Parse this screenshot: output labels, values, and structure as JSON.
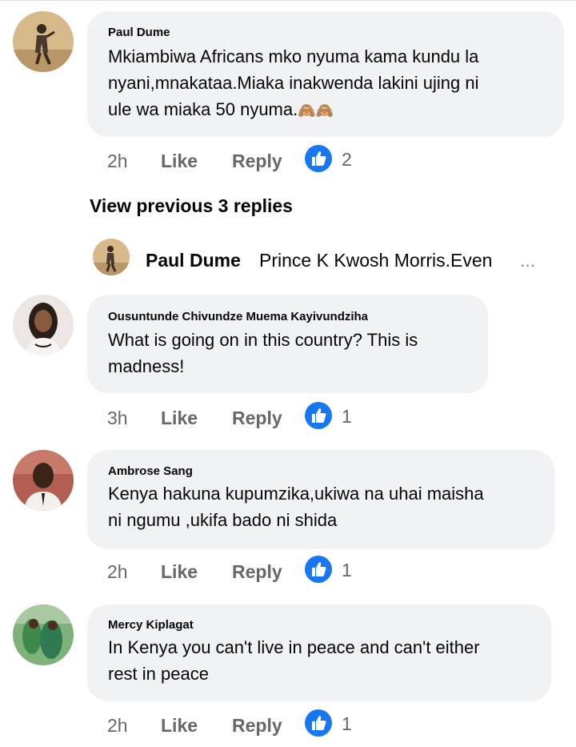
{
  "comments": [
    {
      "author": "Paul Dume",
      "lines": [
        "Mkiambiwa Africans mko nyuma kama kundu la",
        "nyani,mnakataa.Miaka inakwenda lakini ujing ni",
        "ule wa miaka 50 nyuma."
      ],
      "emoji": "🙈🙈",
      "time": "2h",
      "like_label": "Like",
      "reply_label": "Reply",
      "likes": "2"
    },
    {
      "author": "Ousuntunde Chivundze Muema Kayivundziha",
      "lines": [
        "What is going on in this country? This is",
        "madness!"
      ],
      "time": "3h",
      "like_label": "Like",
      "reply_label": "Reply",
      "likes": "1"
    },
    {
      "author": "Ambrose Sang",
      "lines": [
        "Kenya hakuna kupumzika,ukiwa na uhai maisha",
        "ni ngumu ,ukifa bado ni shida"
      ],
      "time": "2h",
      "like_label": "Like",
      "reply_label": "Reply",
      "likes": "1"
    },
    {
      "author": "Mercy Kiplagat",
      "lines": [
        "In Kenya you can't live in peace and can't either",
        "rest in peace"
      ],
      "time": "2h",
      "like_label": "Like",
      "reply_label": "Reply",
      "likes": "1"
    }
  ],
  "view_previous": "View previous 3 replies",
  "collapsed_reply": {
    "author": "Paul Dume",
    "snippet": "Prince K Kwosh Morris.Even",
    "ellipsis": "..."
  },
  "colors": {
    "bubble": "#f0f2f5",
    "secondary_text": "#65676b",
    "like_blue": "#1877f2"
  }
}
